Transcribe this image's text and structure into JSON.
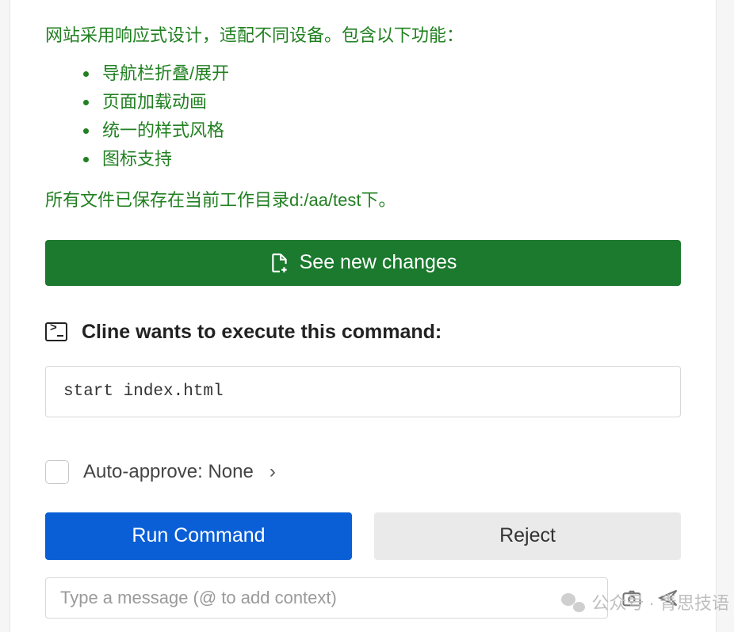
{
  "response": {
    "intro": "网站采用响应式设计，适配不同设备。包含以下功能：",
    "bullets": [
      "导航栏折叠/展开",
      "页面加载动画",
      "统一的样式风格",
      "图标支持"
    ],
    "outro": "所有文件已保存在当前工作目录d:/aa/test下。"
  },
  "buttons": {
    "see_changes": "See new changes",
    "run": "Run Command",
    "reject": "Reject"
  },
  "command": {
    "title": "Cline wants to execute this command:",
    "text": "start index.html"
  },
  "auto_approve": {
    "label_prefix": "Auto-approve:",
    "value": "None"
  },
  "input": {
    "placeholder": "Type a message (@ to add context)"
  },
  "watermark": {
    "text": "公众号 · 青思技语"
  }
}
